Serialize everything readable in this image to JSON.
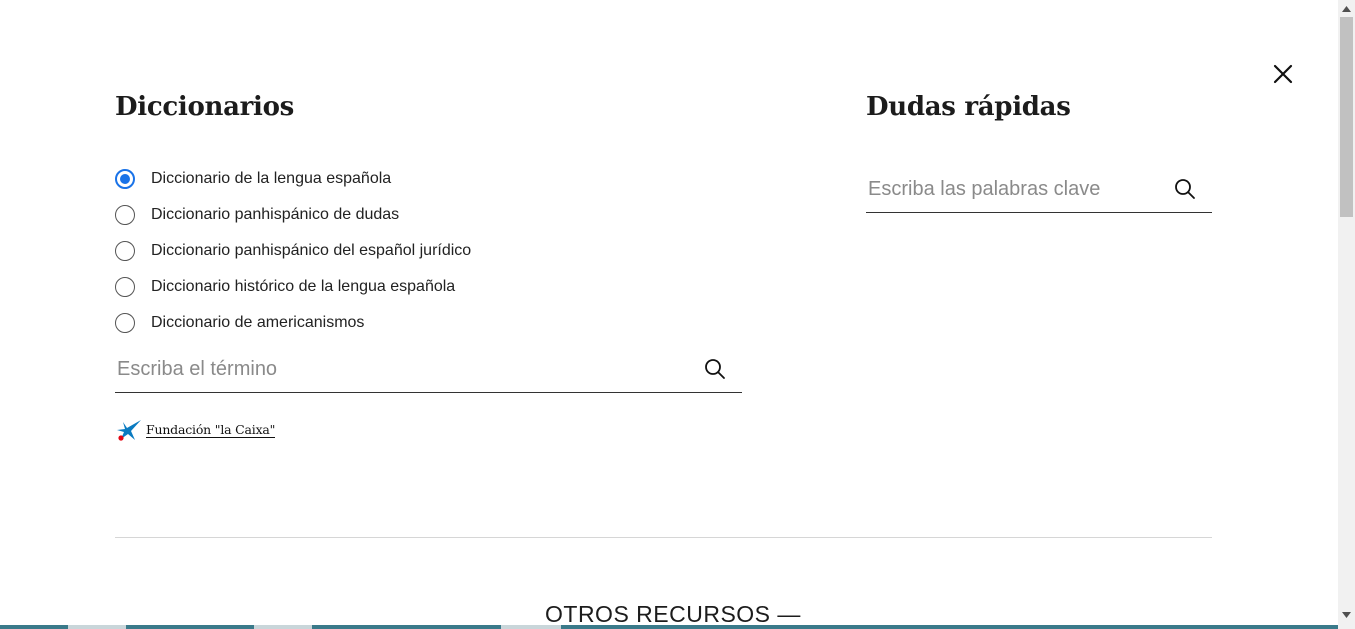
{
  "close": {
    "icon": "close-icon"
  },
  "dictionaries": {
    "heading": "Diccionarios",
    "options": [
      {
        "label": "Diccionario de la lengua española",
        "checked": true
      },
      {
        "label": "Diccionario panhispánico de dudas",
        "checked": false
      },
      {
        "label": "Diccionario panhispánico del español jurídico",
        "checked": false
      },
      {
        "label": "Diccionario histórico de la lengua española",
        "checked": false
      },
      {
        "label": "Diccionario de americanismos",
        "checked": false
      }
    ],
    "search": {
      "placeholder": "Escriba el término",
      "value": "",
      "icon": "search-icon"
    }
  },
  "sponsor": {
    "text": "Fundación \"la Caixa\"",
    "logo": "la-caixa-star-logo",
    "logo_blue": "#0a7bc1",
    "logo_red": "#e30613"
  },
  "quick_doubts": {
    "heading": "Dudas rápidas",
    "search": {
      "placeholder": "Escriba las palabras clave",
      "value": "",
      "icon": "search-icon"
    }
  },
  "other_resources": {
    "label": "OTROS RECURSOS —"
  },
  "colors": {
    "radio_accent": "#1a73e8",
    "text": "#1c1c1c",
    "divider": "#d6d6d6"
  }
}
